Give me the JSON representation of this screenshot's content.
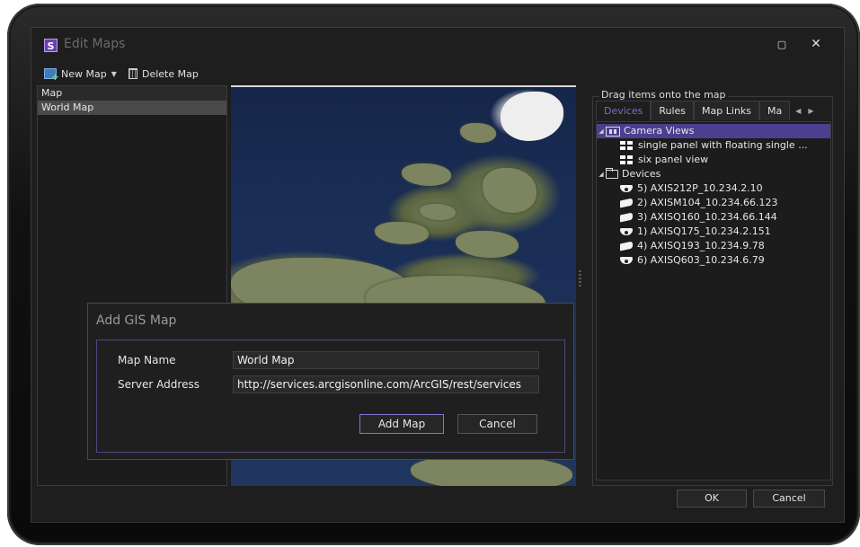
{
  "window": {
    "logo_letter": "S",
    "title": "Edit Maps",
    "maximize_glyph": "▢",
    "close_glyph": "✕"
  },
  "toolbar": {
    "new_map_label": "New Map",
    "delete_map_label": "Delete Map"
  },
  "maps": {
    "header": "Map",
    "items": [
      "World Map"
    ]
  },
  "right_panel": {
    "caption": "Drag items onto the map",
    "tabs": [
      "Devices",
      "Rules",
      "Map Links",
      "Ma"
    ],
    "tree": {
      "camera_views_label": "Camera Views",
      "camera_views": [
        "single panel with floating single ...",
        "six panel view"
      ],
      "devices_label": "Devices",
      "devices": [
        {
          "label": "5) AXIS212P_10.234.2.10",
          "icon": "dome-camera-icon"
        },
        {
          "label": "2) AXISM104_10.234.66.123",
          "icon": "bullet-camera-icon"
        },
        {
          "label": "3) AXISQ160_10.234.66.144",
          "icon": "bullet-camera-icon"
        },
        {
          "label": "1) AXISQ175_10.234.2.151",
          "icon": "dome-camera-icon"
        },
        {
          "label": "4) AXISQ193_10.234.9.78",
          "icon": "bullet-camera-icon"
        },
        {
          "label": "6) AXISQ603_10.234.6.79",
          "icon": "dome-camera-icon"
        }
      ]
    }
  },
  "footer": {
    "ok_label": "OK",
    "cancel_label": "Cancel"
  },
  "dialog": {
    "title": "Add GIS Map",
    "map_name_label": "Map Name",
    "map_name_value": "World Map",
    "server_address_label": "Server Address",
    "server_address_value": "http://services.arcgisonline.com/ArcGIS/rest/services",
    "add_label": "Add Map",
    "cancel_label": "Cancel"
  },
  "colors": {
    "accent": "#7c6ad0",
    "selection": "#4b3f8f",
    "background": "#1e1e1e"
  }
}
